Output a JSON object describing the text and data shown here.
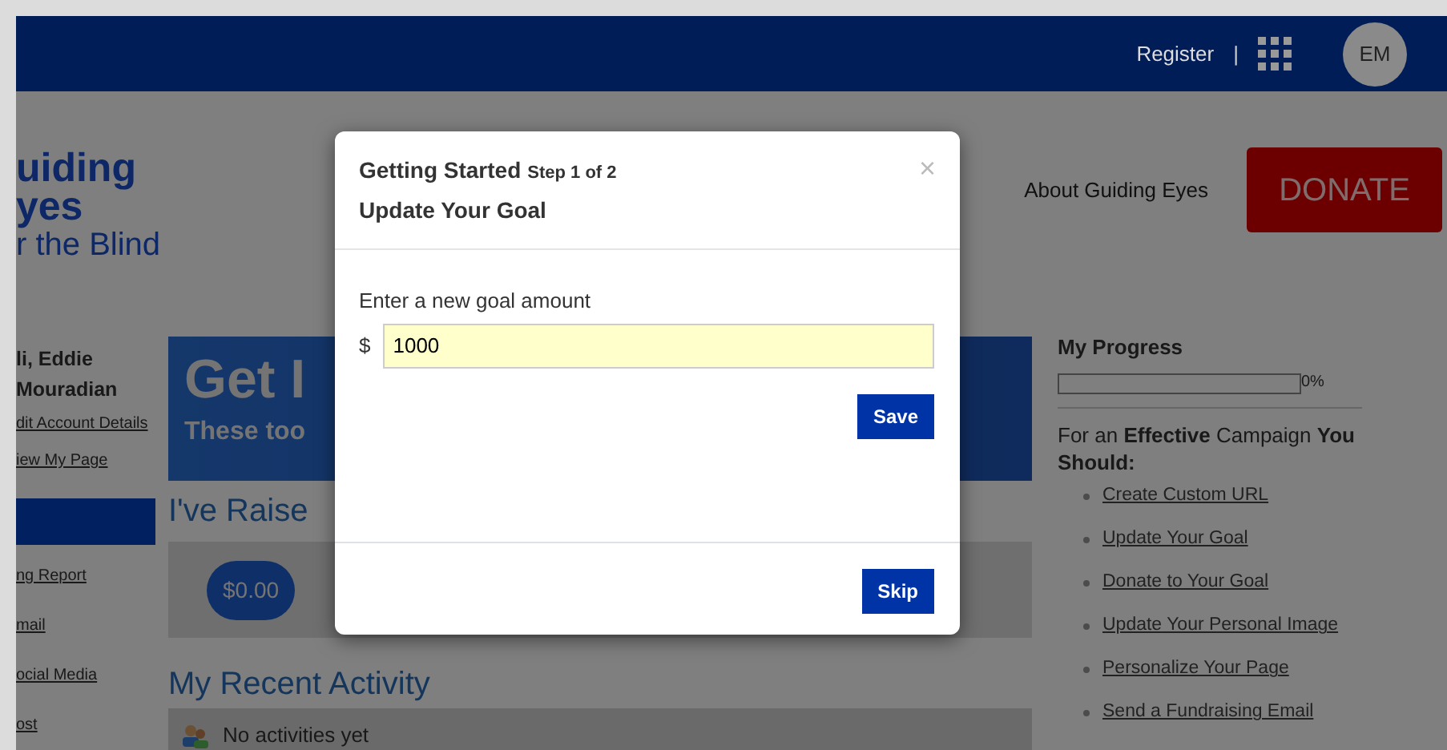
{
  "header": {
    "register_link": "Register",
    "separator": "|",
    "avatar_initials": "EM"
  },
  "logo": {
    "lines": [
      "uiding",
      "yes",
      "r the Blind"
    ]
  },
  "nav": {
    "about_link": "About Guiding Eyes",
    "donate_button": "DONATE"
  },
  "sidebar": {
    "name_lines": [
      "li, Eddie",
      "Mouradian"
    ],
    "account_links": [
      "dit Account Details",
      "iew My Page"
    ],
    "menu_links": [
      "ng Report",
      "mail",
      "ocial Media",
      "ost"
    ]
  },
  "banner": {
    "heading": "Get I",
    "subheading": "These too"
  },
  "raised": {
    "heading": "I've Raise",
    "amount": "$0.00"
  },
  "activity": {
    "heading": "My Recent Activity",
    "empty_text": "No activities yet"
  },
  "progress": {
    "heading": "My Progress",
    "level": 0,
    "reading": "0%"
  },
  "campaign": {
    "intro": "For an **Effective** Campaign **You Should:**",
    "links": [
      "Create Custom URL",
      "Update Your Goal",
      "Donate to Your Goal",
      "Update Your Personal Image",
      "Personalize Your Page",
      "Send a Fundraising Email"
    ]
  },
  "modal": {
    "title": "Getting Started",
    "step": "Step 1 of 2",
    "subtitle": "Update Your Goal",
    "close": "×",
    "field_label": "Enter a new goal amount",
    "currency": "$",
    "goal_value": "1000",
    "save_button": "Save",
    "skip_button": "Skip"
  }
}
